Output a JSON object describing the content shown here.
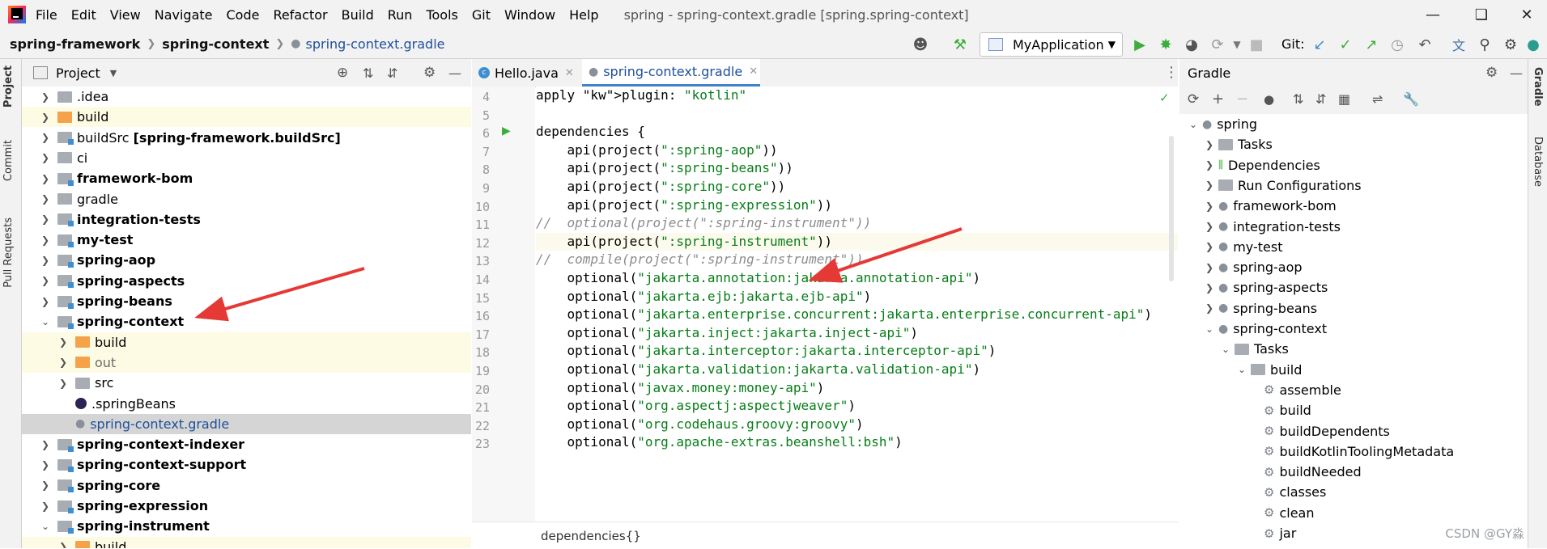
{
  "menubar": {
    "items": [
      "File",
      "Edit",
      "View",
      "Navigate",
      "Code",
      "Refactor",
      "Build",
      "Run",
      "Tools",
      "Git",
      "Window",
      "Help"
    ],
    "title": "spring - spring-context.gradle [spring.spring-context]"
  },
  "navbar": {
    "crumbs": [
      "spring-framework",
      "spring-context"
    ],
    "file": "spring-context.gradle",
    "run_config": "MyApplication",
    "git_label": "Git:"
  },
  "left_strip": {
    "tabs": [
      "Project",
      "Commit",
      "Pull Requests"
    ]
  },
  "project": {
    "title": "Project",
    "rows": [
      {
        "label": ".idea",
        "depth": 1,
        "icon": "folder-gray",
        "bold": false,
        "hl": false,
        "expanded": false
      },
      {
        "label": "build",
        "depth": 1,
        "icon": "folder-orange",
        "bold": false,
        "hl": true,
        "expanded": false
      },
      {
        "label": "buildSrc [spring-framework.buildSrc]",
        "depth": 1,
        "icon": "folder-module",
        "bold": false,
        "hl": false,
        "expanded": false,
        "bold_suffix": true
      },
      {
        "label": "ci",
        "depth": 1,
        "icon": "folder-gray",
        "bold": false,
        "hl": false,
        "expanded": false
      },
      {
        "label": "framework-bom",
        "depth": 1,
        "icon": "folder-module",
        "bold": true,
        "hl": false,
        "expanded": false
      },
      {
        "label": "gradle",
        "depth": 1,
        "icon": "folder-gray",
        "bold": false,
        "hl": false,
        "expanded": false
      },
      {
        "label": "integration-tests",
        "depth": 1,
        "icon": "folder-module",
        "bold": true,
        "hl": false,
        "expanded": false
      },
      {
        "label": "my-test",
        "depth": 1,
        "icon": "folder-module",
        "bold": true,
        "hl": false,
        "expanded": false
      },
      {
        "label": "spring-aop",
        "depth": 1,
        "icon": "folder-module",
        "bold": true,
        "hl": false,
        "expanded": false
      },
      {
        "label": "spring-aspects",
        "depth": 1,
        "icon": "folder-module",
        "bold": true,
        "hl": false,
        "expanded": false
      },
      {
        "label": "spring-beans",
        "depth": 1,
        "icon": "folder-module",
        "bold": true,
        "hl": false,
        "expanded": false
      },
      {
        "label": "spring-context",
        "depth": 1,
        "icon": "folder-module",
        "bold": true,
        "hl": false,
        "expanded": true
      },
      {
        "label": "build",
        "depth": 2,
        "icon": "folder-orange",
        "bold": false,
        "hl": true,
        "expanded": false
      },
      {
        "label": "out",
        "depth": 2,
        "icon": "folder-orange",
        "bold": false,
        "hl": true,
        "expanded": false,
        "muted": true
      },
      {
        "label": "src",
        "depth": 2,
        "icon": "folder-gray",
        "bold": false,
        "hl": false,
        "expanded": false
      },
      {
        "label": ".springBeans",
        "depth": 2,
        "icon": "eclipse-file",
        "bold": false,
        "hl": false,
        "leaf": true
      },
      {
        "label": "spring-context.gradle",
        "depth": 2,
        "icon": "gradle-file",
        "bold": false,
        "hl": false,
        "leaf": true,
        "selected": true
      },
      {
        "label": "spring-context-indexer",
        "depth": 1,
        "icon": "folder-module",
        "bold": true,
        "hl": false,
        "expanded": false
      },
      {
        "label": "spring-context-support",
        "depth": 1,
        "icon": "folder-module",
        "bold": true,
        "hl": false,
        "expanded": false
      },
      {
        "label": "spring-core",
        "depth": 1,
        "icon": "folder-module",
        "bold": true,
        "hl": false,
        "expanded": false
      },
      {
        "label": "spring-expression",
        "depth": 1,
        "icon": "folder-module",
        "bold": true,
        "hl": false,
        "expanded": false
      },
      {
        "label": "spring-instrument",
        "depth": 1,
        "icon": "folder-module",
        "bold": true,
        "hl": false,
        "expanded": true
      },
      {
        "label": "build",
        "depth": 2,
        "icon": "folder-orange",
        "bold": false,
        "hl": true,
        "expanded": false
      }
    ]
  },
  "editor": {
    "tabs": [
      {
        "label": "Hello.java",
        "icon": "java-class-icon",
        "active": false
      },
      {
        "label": "spring-context.gradle",
        "icon": "gradle-file-icon",
        "active": true
      }
    ],
    "lines": [
      {
        "n": "4",
        "code": "apply plugin: \"kotlin\"",
        "kind": "apply"
      },
      {
        "n": "5",
        "code": "",
        "kind": "blank"
      },
      {
        "n": "6",
        "code": "dependencies {",
        "kind": "plain",
        "run": true
      },
      {
        "n": "7",
        "code": "    api(project(\":spring-aop\"))",
        "kind": "call"
      },
      {
        "n": "8",
        "code": "    api(project(\":spring-beans\"))",
        "kind": "call"
      },
      {
        "n": "9",
        "code": "    api(project(\":spring-core\"))",
        "kind": "call"
      },
      {
        "n": "10",
        "code": "    api(project(\":spring-expression\"))",
        "kind": "call"
      },
      {
        "n": "11",
        "code": "//  optional(project(\":spring-instrument\"))",
        "kind": "comment"
      },
      {
        "n": "12",
        "code": "    api(project(\":spring-instrument\"))",
        "kind": "call",
        "current": true
      },
      {
        "n": "13",
        "code": "//  compile(project(\":spring-instrument\"))",
        "kind": "comment"
      },
      {
        "n": "14",
        "code": "    optional(\"jakarta.annotation:jakarta.annotation-api\")",
        "kind": "call"
      },
      {
        "n": "15",
        "code": "    optional(\"jakarta.ejb:jakarta.ejb-api\")",
        "kind": "call"
      },
      {
        "n": "16",
        "code": "    optional(\"jakarta.enterprise.concurrent:jakarta.enterprise.concurrent-api\")",
        "kind": "call"
      },
      {
        "n": "17",
        "code": "    optional(\"jakarta.inject:jakarta.inject-api\")",
        "kind": "call"
      },
      {
        "n": "18",
        "code": "    optional(\"jakarta.interceptor:jakarta.interceptor-api\")",
        "kind": "call"
      },
      {
        "n": "19",
        "code": "    optional(\"jakarta.validation:jakarta.validation-api\")",
        "kind": "call"
      },
      {
        "n": "20",
        "code": "    optional(\"javax.money:money-api\")",
        "kind": "call"
      },
      {
        "n": "21",
        "code": "    optional(\"org.aspectj:aspectjweaver\")",
        "kind": "call"
      },
      {
        "n": "22",
        "code": "    optional(\"org.codehaus.groovy:groovy\")",
        "kind": "call"
      },
      {
        "n": "23",
        "code": "    optional(\"org.apache-extras.beanshell:bsh\")",
        "kind": "call"
      }
    ],
    "breadcrumb": "dependencies{}"
  },
  "gradle": {
    "title": "Gradle",
    "rows": [
      {
        "label": "spring",
        "depth": 0,
        "icon": "elephant",
        "expanded": true
      },
      {
        "label": "Tasks",
        "depth": 1,
        "icon": "tasks-folder",
        "expanded": false
      },
      {
        "label": "Dependencies",
        "depth": 1,
        "icon": "deps-icon",
        "expanded": false
      },
      {
        "label": "Run Configurations",
        "depth": 1,
        "icon": "runconf-icon",
        "expanded": false
      },
      {
        "label": "framework-bom",
        "depth": 1,
        "icon": "elephant",
        "expanded": false
      },
      {
        "label": "integration-tests",
        "depth": 1,
        "icon": "elephant",
        "expanded": false
      },
      {
        "label": "my-test",
        "depth": 1,
        "icon": "elephant",
        "expanded": false
      },
      {
        "label": "spring-aop",
        "depth": 1,
        "icon": "elephant",
        "expanded": false
      },
      {
        "label": "spring-aspects",
        "depth": 1,
        "icon": "elephant",
        "expanded": false
      },
      {
        "label": "spring-beans",
        "depth": 1,
        "icon": "elephant",
        "expanded": false
      },
      {
        "label": "spring-context",
        "depth": 1,
        "icon": "elephant",
        "expanded": true
      },
      {
        "label": "Tasks",
        "depth": 2,
        "icon": "tasks-folder",
        "expanded": true
      },
      {
        "label": "build",
        "depth": 3,
        "icon": "tasks-folder",
        "expanded": true
      },
      {
        "label": "assemble",
        "depth": 4,
        "icon": "gear",
        "leaf": true
      },
      {
        "label": "build",
        "depth": 4,
        "icon": "gear",
        "leaf": true
      },
      {
        "label": "buildDependents",
        "depth": 4,
        "icon": "gear",
        "leaf": true
      },
      {
        "label": "buildKotlinToolingMetadata",
        "depth": 4,
        "icon": "gear",
        "leaf": true
      },
      {
        "label": "buildNeeded",
        "depth": 4,
        "icon": "gear",
        "leaf": true
      },
      {
        "label": "classes",
        "depth": 4,
        "icon": "gear",
        "leaf": true
      },
      {
        "label": "clean",
        "depth": 4,
        "icon": "gear",
        "leaf": true
      },
      {
        "label": "jar",
        "depth": 4,
        "icon": "gear",
        "leaf": true
      }
    ]
  },
  "right_strip": {
    "tabs": [
      "Gradle",
      "Database"
    ]
  },
  "watermark": "CSDN @GY淼",
  "colors": {
    "accent": "#1f4f9a",
    "string": "#067d17",
    "keyword": "#0033b3",
    "arrow": "#e53935",
    "run_green": "#3dae3d"
  }
}
